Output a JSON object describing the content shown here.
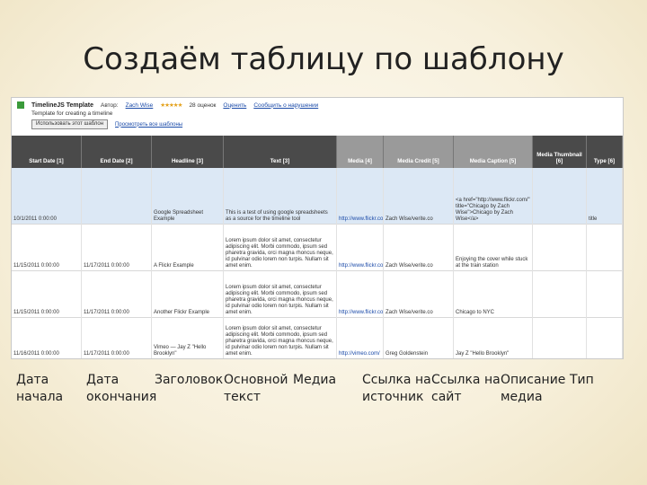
{
  "title": "Создаём таблицу по шаблону",
  "screenshot": {
    "template_name": "TimelineJS Template",
    "author_label": "Автор:",
    "author": "Zach Wise",
    "stars": "★★★★★",
    "rating_count": "28 оценок",
    "rate_link": "Оценить",
    "report_link": "Сообщить о нарушении",
    "description": "Template for creating a timeline",
    "use_button": "Использовать этот шаблон",
    "all_templates_link": "Просмотреть все шаблоны",
    "columns": [
      "Start Date [1]",
      "End Date [2]",
      "Headline [3]",
      "Text [3]",
      "Media [4]",
      "Media Credit [5]",
      "Media Caption [5]",
      "Media Thumbnail [6]",
      "Type [6]"
    ],
    "rows": [
      {
        "start": "10/1/2011 0:00:00",
        "end": "",
        "headline": "Google Spreadsheet Example",
        "text": "This is a test of using google spreadsheets as a source for the timeline tool",
        "media": "http://www.flickr.com",
        "credit": "Zach Wise/verite.co",
        "caption": "<a href=\"http://www.flickr.com/\" title=\"Chicago by Zach Wise\">Chicago by Zach Wise</a>",
        "thumb": "",
        "type": "title"
      },
      {
        "start": "11/15/2011 0:00:00",
        "end": "11/17/2011 0:00:00",
        "headline": "A Flickr Example",
        "text": "Lorem ipsum dolor sit amet, consectetur adipiscing elit. Morbi commodo, ipsum sed pharetra gravida, orci magna rhoncus neque, id pulvinar odio lorem non turpis. Nullam sit amet enim.",
        "media": "http://www.flickr.com",
        "credit": "Zach Wise/verite.co",
        "caption": "Enjoying the cover while stuck at the train station",
        "thumb": "",
        "type": ""
      },
      {
        "start": "11/15/2011 0:00:00",
        "end": "11/17/2011 0:00:00",
        "headline": "Another Flickr Example",
        "text": "Lorem ipsum dolor sit amet, consectetur adipiscing elit. Morbi commodo, ipsum sed pharetra gravida, orci magna rhoncus neque, id pulvinar odio lorem non turpis. Nullam sit amet enim.",
        "media": "http://www.flickr.com",
        "credit": "Zach Wise/verite.co",
        "caption": "Chicago to NYC",
        "thumb": "",
        "type": ""
      },
      {
        "start": "11/16/2011 0:00:00",
        "end": "11/17/2011 0:00:00",
        "headline": "Vimeo — Jay Z \"Hello Brooklyn\"",
        "text": "Lorem ipsum dolor sit amet, consectetur adipiscing elit. Morbi commodo, ipsum sed pharetra gravida, orci magna rhoncus neque, id pulvinar odio lorem non turpis. Nullam sit amet enim.",
        "media": "http://vimeo.com/",
        "credit": "Greg Goldenstein",
        "caption": "Jay Z \"Hello Brooklyn\"",
        "thumb": "",
        "type": ""
      }
    ]
  },
  "labels": [
    "Дата\nначала",
    "Дата\nокончания",
    "Заголовок",
    "Основной\nтекст",
    "Медиа",
    "Ссылка на\nисточник",
    "Ссылка на\nсайт",
    "Описание\nмедиа",
    "Тип"
  ]
}
